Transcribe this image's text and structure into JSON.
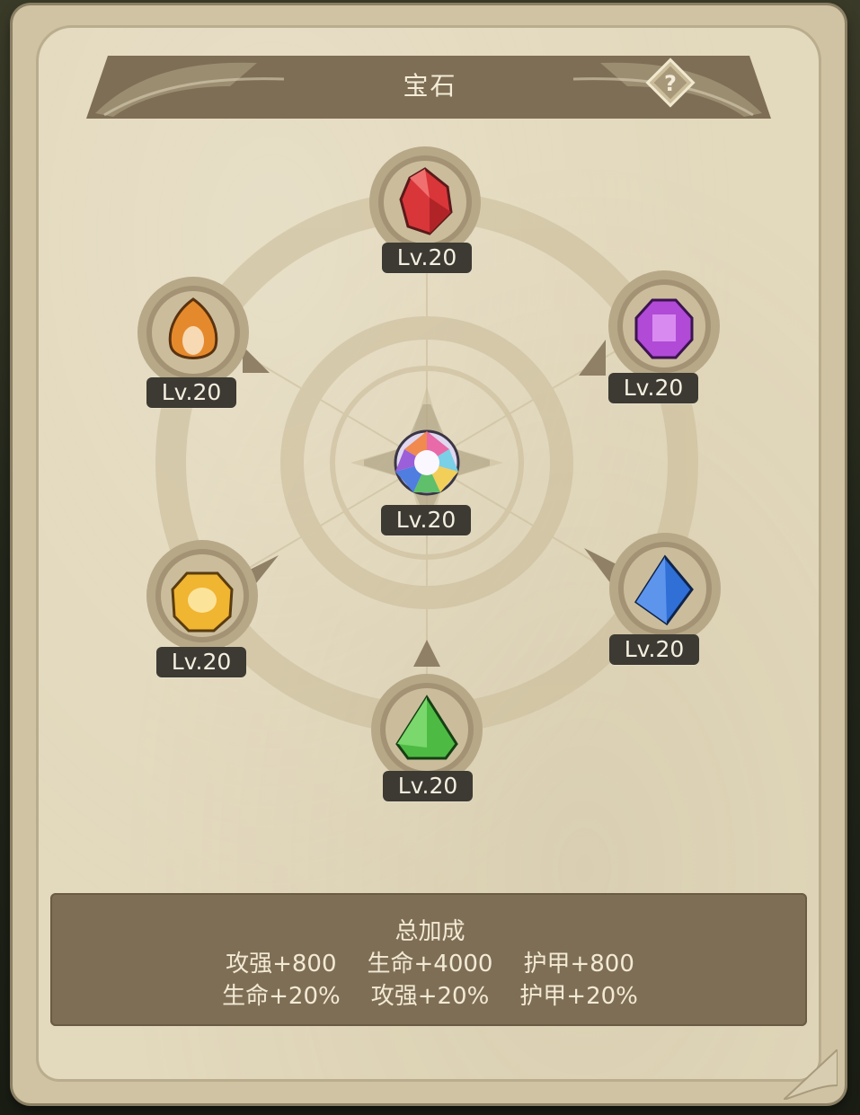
{
  "title": "宝石",
  "help_icon": "question-mark-icon",
  "gems": [
    {
      "id": "red",
      "icon": "red-gem-icon",
      "color": "#d9363a",
      "level": "Lv.20"
    },
    {
      "id": "orange",
      "icon": "orange-gem-icon",
      "color": "#e58a2c",
      "level": "Lv.20"
    },
    {
      "id": "purple",
      "icon": "purple-gem-icon",
      "color": "#b14ad6",
      "level": "Lv.20"
    },
    {
      "id": "rainbow",
      "icon": "rainbow-gem-icon",
      "color": "#e0d8f0",
      "level": "Lv.20"
    },
    {
      "id": "yellow",
      "icon": "yellow-gem-icon",
      "color": "#f0b531",
      "level": "Lv.20"
    },
    {
      "id": "blue",
      "icon": "blue-gem-icon",
      "color": "#2f6fd6",
      "level": "Lv.20"
    },
    {
      "id": "green",
      "icon": "green-gem-icon",
      "color": "#4dbb43",
      "level": "Lv.20"
    }
  ],
  "bonus": {
    "title": "总加成",
    "row1": [
      "攻强+800",
      "生命+4000",
      "护甲+800"
    ],
    "row2": [
      "生命+20%",
      "攻强+20%",
      "护甲+20%"
    ]
  },
  "colors": {
    "parchment": "#e3d9bd",
    "banner": "#7e6e55",
    "badge": "#3c3a33"
  }
}
